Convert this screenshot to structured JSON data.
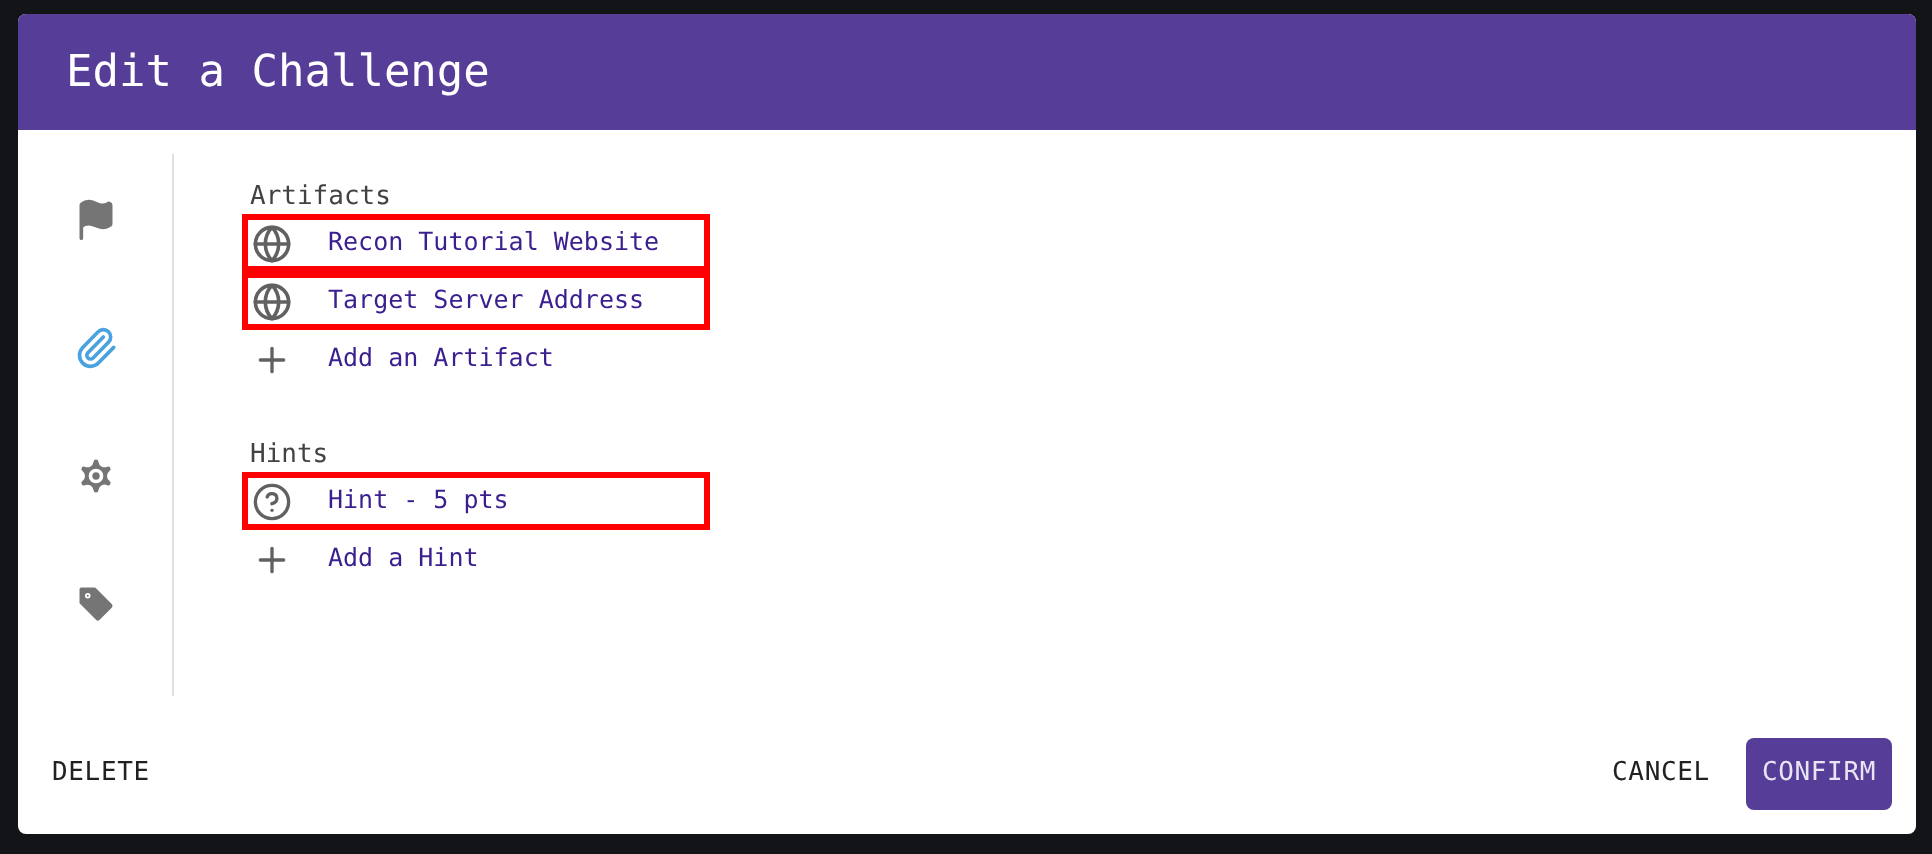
{
  "dialog": {
    "title": "Edit a Challenge"
  },
  "side_nav": [
    {
      "kind": "flag",
      "selected": false
    },
    {
      "kind": "attachment",
      "selected": true
    },
    {
      "kind": "settings",
      "selected": false
    },
    {
      "kind": "tag",
      "selected": false
    }
  ],
  "sections": [
    {
      "heading": "Artifacts",
      "items": [
        {
          "kind": "link",
          "label": "Recon Tutorial Website",
          "highlighted": true
        },
        {
          "kind": "link",
          "label": "Target Server Address",
          "highlighted": true
        },
        {
          "kind": "add",
          "label": "Add an Artifact",
          "highlighted": false
        }
      ]
    },
    {
      "heading": "Hints",
      "items": [
        {
          "kind": "hint",
          "label": "Hint - 5 pts",
          "highlighted": true
        },
        {
          "kind": "add",
          "label": "Add a Hint",
          "highlighted": false
        }
      ]
    }
  ],
  "actions": {
    "delete": "DELETE",
    "cancel": "CANCEL",
    "confirm": "CONFIRM"
  }
}
